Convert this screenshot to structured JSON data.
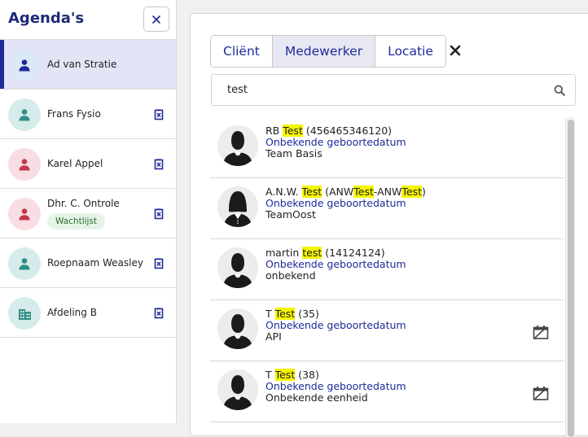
{
  "sidebar": {
    "title": "Agenda's",
    "items": [
      {
        "name": "Ad van Stratie",
        "icon": "person-icon",
        "color": "blue",
        "active": true,
        "badge": ""
      },
      {
        "name": "Frans Fysio",
        "icon": "person-icon",
        "color": "teal",
        "active": false,
        "badge": ""
      },
      {
        "name": "Karel Appel",
        "icon": "person-icon",
        "color": "pink",
        "active": false,
        "badge": ""
      },
      {
        "name": "Dhr. C. Ontrole",
        "icon": "person-icon",
        "color": "pink",
        "active": false,
        "badge": "Wachtlijst"
      },
      {
        "name": "Roepnaam Weasley",
        "icon": "person-icon",
        "color": "teal",
        "active": false,
        "badge": ""
      },
      {
        "name": "Afdeling B",
        "icon": "building-icon",
        "color": "teal",
        "active": false,
        "badge": ""
      }
    ]
  },
  "panel": {
    "tabs": [
      {
        "label": "Cliënt",
        "active": false
      },
      {
        "label": "Medewerker",
        "active": true
      },
      {
        "label": "Locatie",
        "active": false
      }
    ],
    "search_value": "test"
  },
  "results": [
    {
      "avatar": "male-silhouette-icon",
      "name": [
        [
          "RB ",
          false
        ],
        [
          "Test",
          true
        ],
        [
          " (456465346120)",
          false
        ]
      ],
      "dob": "Onbekende geboortedatum",
      "team": "Team Basis",
      "icon": ""
    },
    {
      "avatar": "female-silhouette-icon",
      "name": [
        [
          "A.N.W. ",
          false
        ],
        [
          "Test",
          true
        ],
        [
          " (ANW",
          false
        ],
        [
          "Test",
          true
        ],
        [
          "-ANW",
          false
        ],
        [
          "Test",
          true
        ],
        [
          ")",
          false
        ]
      ],
      "dob": "Onbekende geboortedatum",
      "team": "TeamOost",
      "icon": ""
    },
    {
      "avatar": "male-silhouette-icon",
      "name": [
        [
          "martin ",
          false
        ],
        [
          "test",
          true
        ],
        [
          " (14124124)",
          false
        ]
      ],
      "dob": "Onbekende geboortedatum",
      "team": "onbekend",
      "icon": ""
    },
    {
      "avatar": "male-silhouette-icon",
      "name": [
        [
          "T ",
          false
        ],
        [
          "Test",
          true
        ],
        [
          " (35)",
          false
        ]
      ],
      "dob": "Onbekende geboortedatum",
      "team": "API",
      "icon": "calendar-off-icon"
    },
    {
      "avatar": "male-silhouette-icon",
      "name": [
        [
          "T ",
          false
        ],
        [
          "Test",
          true
        ],
        [
          " (38)",
          false
        ]
      ],
      "dob": "Onbekende geboortedatum",
      "team": "Onbekende eenheid",
      "icon": "calendar-off-icon"
    }
  ],
  "colors": {
    "primary": "#1e2a98",
    "highlight": "#f5f500",
    "teal": "#2f8f86",
    "pink": "#c2384f"
  }
}
